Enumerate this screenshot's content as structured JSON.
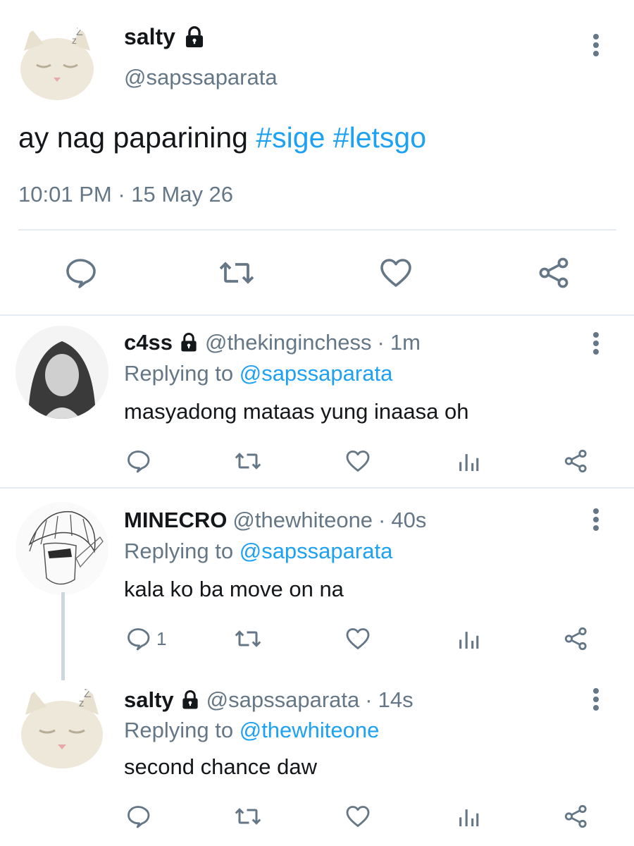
{
  "main_tweet": {
    "display_name": "salty",
    "handle": "@sapssaparata",
    "text_plain": "ay nag paparining ",
    "hashtags": [
      "#sige",
      "#letsgo"
    ],
    "time": "10:01 PM",
    "date": "15 May 26",
    "separator": "·"
  },
  "replies": [
    {
      "display_name": "c4ss",
      "handle": "@thekinginchess",
      "age": "1m",
      "replying_prefix": "Replying to ",
      "replying_to": "@sapssaparata",
      "text": "masyadong mataas yung inaasa oh",
      "reply_count": ""
    },
    {
      "display_name": "MINECRO",
      "handle": "@thewhiteone",
      "age": "40s",
      "replying_prefix": "Replying to ",
      "replying_to": "@sapssaparata",
      "text": "kala ko ba move on na",
      "reply_count": "1"
    },
    {
      "display_name": "salty",
      "handle": "@sapssaparata",
      "age": "14s",
      "replying_prefix": "Replying to ",
      "replying_to": "@thewhiteone",
      "text": "second chance daw",
      "reply_count": ""
    }
  ],
  "colors": {
    "link": "#1da1f2",
    "secondary_text": "#657786",
    "divider": "#e6ecf0",
    "thread_line": "#ccd6dd"
  },
  "icons": [
    "lock-icon",
    "more-options-icon",
    "reply-icon",
    "retweet-icon",
    "like-icon",
    "analytics-icon",
    "share-icon"
  ]
}
